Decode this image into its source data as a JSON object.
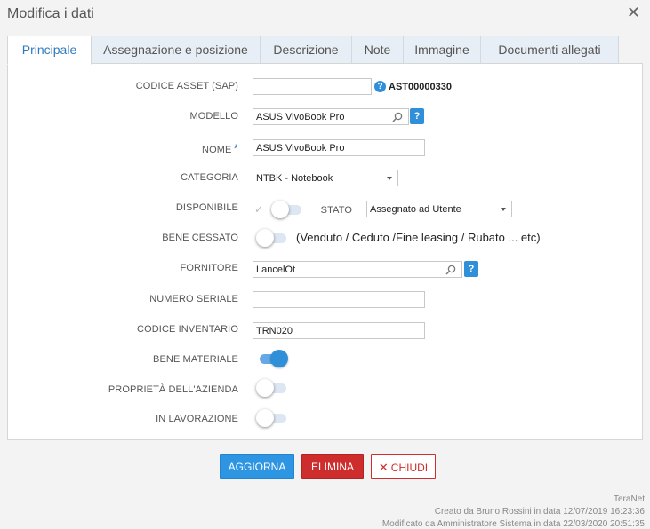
{
  "dialog": {
    "title": "Modifica i dati"
  },
  "tabs": [
    {
      "label": "Principale"
    },
    {
      "label": "Assegnazione e posizione"
    },
    {
      "label": "Descrizione"
    },
    {
      "label": "Note"
    },
    {
      "label": "Immagine"
    },
    {
      "label": "Documenti allegati"
    }
  ],
  "form": {
    "codice_asset": {
      "label": "CODICE ASSET (SAP)",
      "value": "",
      "code": "AST00000330",
      "help": "?"
    },
    "modello": {
      "label": "MODELLO",
      "value": "ASUS VivoBook Pro",
      "help": "?"
    },
    "nome": {
      "label": "NOME",
      "required_mark": "*",
      "value": "ASUS VivoBook Pro"
    },
    "categoria": {
      "label": "CATEGORIA",
      "value": "NTBK - Notebook"
    },
    "disponibile": {
      "label": "DISPONIBILE",
      "check": "✓",
      "on": false
    },
    "stato": {
      "label": "STATO",
      "value": "Assegnato ad Utente"
    },
    "bene_cessato": {
      "label": "BENE CESSATO",
      "on": false,
      "note": "(Venduto / Ceduto /Fine leasing / Rubato ... etc)"
    },
    "fornitore": {
      "label": "FORNITORE",
      "value": "LancelOt",
      "help": "?"
    },
    "numero_seriale": {
      "label": "NUMERO SERIALE",
      "value": ""
    },
    "codice_inventario": {
      "label": "CODICE INVENTARIO",
      "value": "TRN020"
    },
    "bene_materiale": {
      "label": "BENE MATERIALE",
      "on": true
    },
    "proprieta_azienda": {
      "label": "PROPRIETÀ DELL'AZIENDA",
      "on": false
    },
    "in_lavorazione": {
      "label": "IN LAVORAZIONE",
      "on": false
    }
  },
  "buttons": {
    "aggiorna": "AGGIORNA",
    "elimina": "ELIMINA",
    "chiudi": "CHIUDI",
    "close_glyph": "✕"
  },
  "footer": {
    "app": "TeraNet",
    "created": "Creato da Bruno Rossini in data 12/07/2019 16:23:36",
    "modified": "Modificato da Amministratore Sistema in data 22/03/2020 20:51:35"
  },
  "colors": {
    "accent": "#2f8fd8",
    "danger": "#cd2d2d",
    "tab_active_text": "#2f7bbf"
  }
}
